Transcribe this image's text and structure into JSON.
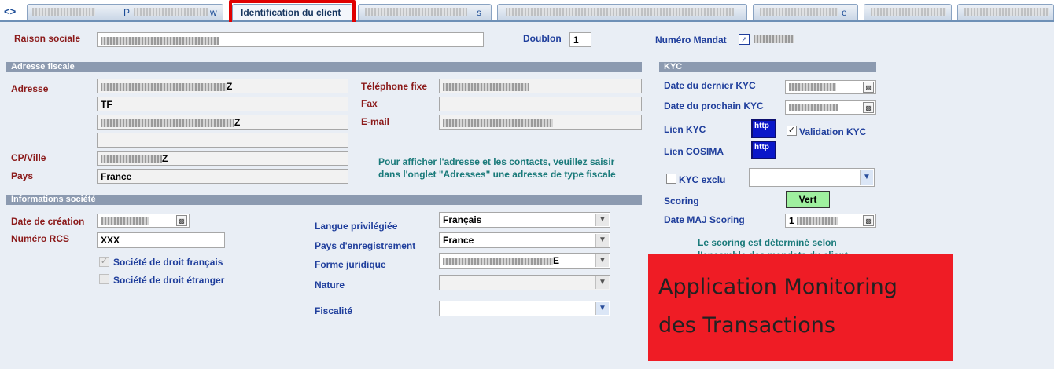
{
  "tabs": {
    "nav": "<>",
    "partial_1": "P",
    "partial_2": "w",
    "active": "Identification du client",
    "partial_3": "s",
    "partial_4": "e"
  },
  "header": {
    "raison_sociale_label": "Raison sociale",
    "doublon_label": "Doublon",
    "doublon_value": "1",
    "numero_mandat_label": "Numéro Mandat"
  },
  "adresse": {
    "section_title": "Adresse fiscale",
    "adresse_label": "Adresse",
    "line1_suffix": "Z",
    "line2": "TF",
    "line3_suffix": "Z",
    "cp_ville_label": "CP/Ville",
    "cp_ville_suffix": "Z",
    "pays_label": "Pays",
    "pays_value": "France",
    "telephone_label": "Téléphone fixe",
    "fax_label": "Fax",
    "email_label": "E-mail",
    "note_line1": "Pour afficher l'adresse et les contacts, veuillez saisir",
    "note_line2": "dans l'onglet \"Adresses\" une adresse de type fiscale"
  },
  "societe": {
    "section_title": "Informations société",
    "date_creation_label": "Date de création",
    "numero_rcs_label": "Numéro RCS",
    "numero_rcs_value": "XXX",
    "droit_francais_label": "Société de droit français",
    "droit_etranger_label": "Société de droit étranger",
    "droit_francais_checked": true,
    "droit_etranger_checked": false,
    "langue_label": "Langue privilégiée",
    "langue_value": "Français",
    "pays_enreg_label": "Pays d'enregistrement",
    "pays_enreg_value": "France",
    "forme_label": "Forme juridique",
    "forme_suffix": "E",
    "nature_label": "Nature",
    "fiscalite_label": "Fiscalité"
  },
  "kyc": {
    "section_title": "KYC",
    "dernier_label": "Date du dernier KYC",
    "prochain_label": "Date du prochain KYC",
    "lien_kyc_label": "Lien KYC",
    "lien_kyc_button": "http",
    "validation_label": "Validation KYC",
    "validation_checked": true,
    "lien_cosima_label": "Lien COSIMA",
    "lien_cosima_button": "http",
    "exclu_label": "KYC exclu",
    "exclu_checked": false,
    "scoring_label": "Scoring",
    "scoring_value": "Vert",
    "date_maj_label": "Date MAJ Scoring",
    "date_maj_prefix": "1",
    "scoring_note_line1": "Le scoring est déterminé selon",
    "scoring_note_line2": "l'ensemble des mandats du client"
  },
  "overlay": {
    "line1": "Application Monitoring",
    "line2": "des Transactions"
  },
  "colors": {
    "label_red": "#8b1a1a",
    "label_blue": "#1f3e9c",
    "highlight": "#e00000",
    "scoring_green": "#9ff09f",
    "overlay_red": "#ef1c25"
  }
}
